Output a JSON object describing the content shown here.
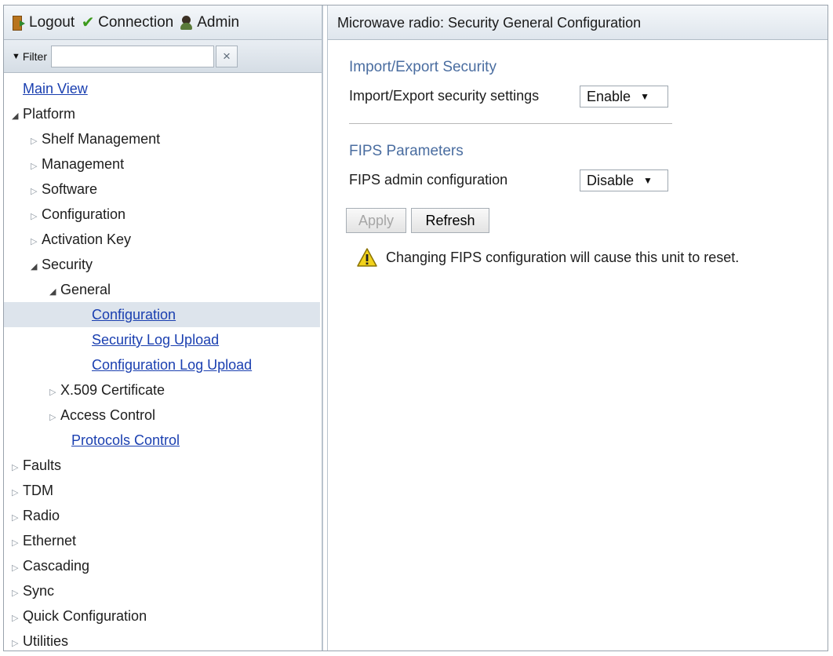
{
  "toolbar": {
    "logout": "Logout",
    "connection": "Connection",
    "admin": "Admin"
  },
  "filter": {
    "label": "Filter",
    "value": "",
    "clear": "×"
  },
  "tree": {
    "main_view": "Main View",
    "platform": "Platform",
    "shelf_management": "Shelf Management",
    "management": "Management",
    "software": "Software",
    "configuration": "Configuration",
    "activation_key": "Activation Key",
    "security": "Security",
    "general": "General",
    "general_configuration": "Configuration",
    "security_log_upload": "Security Log Upload",
    "configuration_log_upload": "Configuration Log Upload",
    "x509": "X.509 Certificate",
    "access_control": "Access Control",
    "protocols_control": "Protocols Control",
    "faults": "Faults",
    "tdm": "TDM",
    "radio": "Radio",
    "ethernet": "Ethernet",
    "cascading": "Cascading",
    "sync": "Sync",
    "quick_configuration": "Quick Configuration",
    "utilities": "Utilities"
  },
  "page": {
    "title": "Microwave radio: Security General Configuration",
    "import_export": {
      "section_title": "Import/Export Security",
      "label": "Import/Export security settings",
      "value": "Enable"
    },
    "fips": {
      "section_title": "FIPS Parameters",
      "label": "FIPS admin configuration",
      "value": "Disable"
    },
    "buttons": {
      "apply": "Apply",
      "refresh": "Refresh"
    },
    "warning": "Changing FIPS configuration will cause this unit to reset."
  },
  "colors": {
    "link": "#1a3fb0",
    "section_title": "#4a6da0",
    "selected_row": "#dde4ec",
    "warning_icon": "#f2d21b"
  }
}
